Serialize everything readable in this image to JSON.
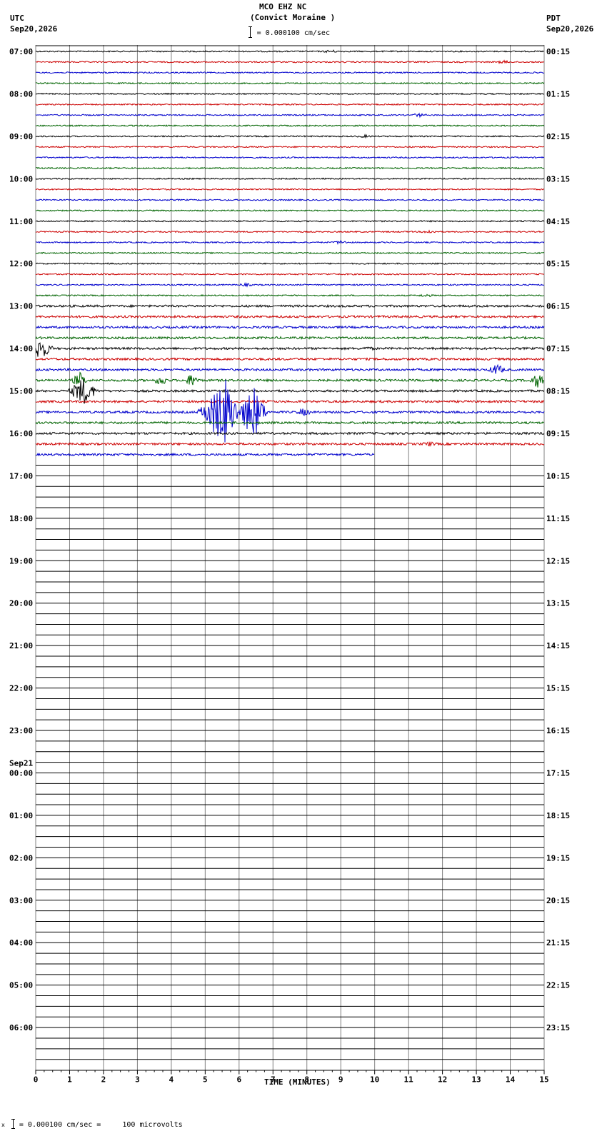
{
  "header": {
    "station": "MCO EHZ NC",
    "location": "(Convict Moraine )",
    "scale_text": "= 0.000100 cm/sec",
    "left_zone": "UTC",
    "left_date": "Sep20,2026",
    "right_zone": "PDT",
    "right_date": "Sep20,2026"
  },
  "footer": {
    "scale_text": "= 0.000100 cm/sec =     100 microvolts",
    "mark": "x"
  },
  "chart_data": {
    "type": "line",
    "xlabel": "TIME (MINUTES)",
    "x_ticks": [
      "0",
      "1",
      "2",
      "3",
      "4",
      "5",
      "6",
      "7",
      "8",
      "9",
      "10",
      "11",
      "12",
      "13",
      "14",
      "15"
    ],
    "xlim": [
      0,
      15
    ],
    "left_hour_labels": [
      "07:00",
      "08:00",
      "09:00",
      "10:00",
      "11:00",
      "12:00",
      "13:00",
      "14:00",
      "15:00",
      "16:00",
      "17:00",
      "18:00",
      "19:00",
      "20:00",
      "21:00",
      "22:00",
      "23:00",
      "00:00",
      "01:00",
      "02:00",
      "03:00",
      "04:00",
      "05:00",
      "06:00"
    ],
    "right_hour_labels": [
      "00:15",
      "01:15",
      "02:15",
      "03:15",
      "04:15",
      "05:15",
      "06:15",
      "07:15",
      "08:15",
      "09:15",
      "10:15",
      "11:15",
      "12:15",
      "13:15",
      "14:15",
      "15:15",
      "16:15",
      "17:15",
      "18:15",
      "19:15",
      "20:15",
      "21:15",
      "22:15",
      "23:15"
    ],
    "date_change": {
      "hour_index": 17,
      "label": "Sep21"
    },
    "trace_rows": 96,
    "recorded_rows": 39,
    "last_row_end_minute": 10,
    "colors": [
      "#000000",
      "#cc0000",
      "#0000cc",
      "#006400"
    ],
    "grid_color": "#808080",
    "events": [
      {
        "row": 0,
        "minute": 8.7,
        "amp": 1.5
      },
      {
        "row": 1,
        "minute": 13.8,
        "amp": 1.5
      },
      {
        "row": 6,
        "minute": 11.3,
        "amp": 2
      },
      {
        "row": 8,
        "minute": 9.7,
        "amp": 1.2
      },
      {
        "row": 17,
        "minute": 11.6,
        "amp": 1.8
      },
      {
        "row": 18,
        "minute": 9.0,
        "amp": 2
      },
      {
        "row": 22,
        "minute": 6.2,
        "amp": 1.5
      },
      {
        "row": 23,
        "minute": 11.5,
        "amp": 1.5
      },
      {
        "row": 28,
        "minute": 0.1,
        "amp": 14
      },
      {
        "row": 28,
        "minute": 9.8,
        "amp": 1.2
      },
      {
        "row": 30,
        "minute": 13.6,
        "amp": 7
      },
      {
        "row": 31,
        "minute": 1.3,
        "amp": 10
      },
      {
        "row": 31,
        "minute": 3.7,
        "amp": 6
      },
      {
        "row": 31,
        "minute": 4.6,
        "amp": 8
      },
      {
        "row": 31,
        "minute": 14.8,
        "amp": 9
      },
      {
        "row": 32,
        "minute": 1.4,
        "amp": 18
      },
      {
        "row": 34,
        "minute": 5.2,
        "amp": 20
      },
      {
        "row": 34,
        "minute": 5.6,
        "amp": 45
      },
      {
        "row": 34,
        "minute": 6.4,
        "amp": 38
      },
      {
        "row": 34,
        "minute": 7.9,
        "amp": 4
      },
      {
        "row": 37,
        "minute": 11.6,
        "amp": 2
      }
    ]
  }
}
